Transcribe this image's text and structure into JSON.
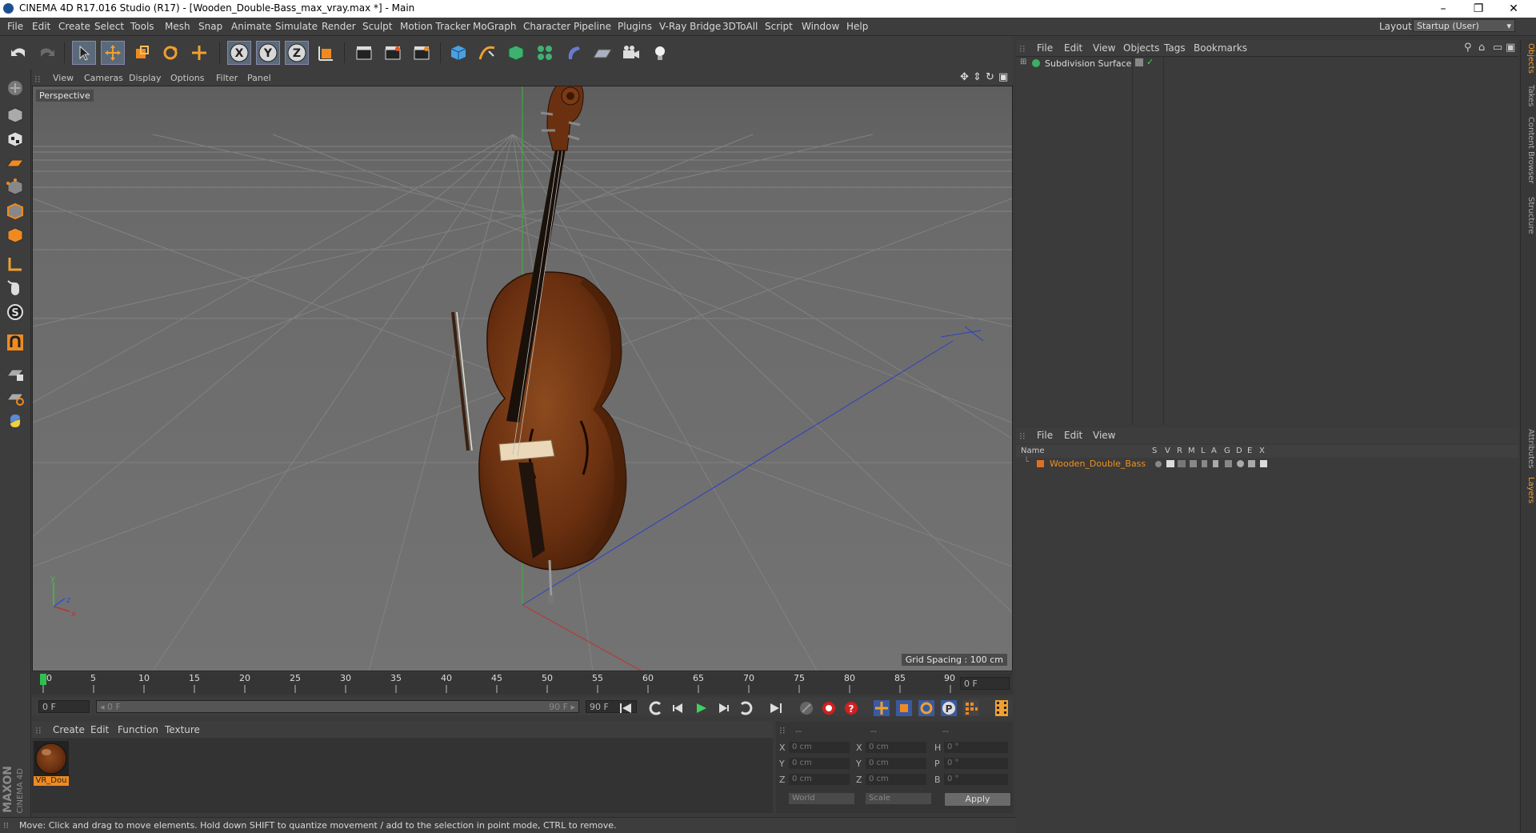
{
  "window": {
    "title": "CINEMA 4D R17.016 Studio (R17) - [Wooden_Double-Bass_max_vray.max *] - Main",
    "controls": [
      "–",
      "❐",
      "✕"
    ]
  },
  "menubar": {
    "items": [
      "File",
      "Edit",
      "Create",
      "Select",
      "Tools",
      "Mesh",
      "Snap",
      "Animate",
      "Simulate",
      "Render",
      "Sculpt",
      "Motion Tracker",
      "MoGraph",
      "Character",
      "Pipeline",
      "Plugins",
      "V-Ray Bridge",
      "3DToAll",
      "Script",
      "Window",
      "Help"
    ],
    "layout_label": "Layout:",
    "layout_value": "Startup (User)"
  },
  "toolbar": {
    "axis_x": "X",
    "axis_y": "Y",
    "axis_z": "Z"
  },
  "viewport": {
    "menu": [
      "View",
      "Cameras",
      "Display",
      "Options",
      "Filter",
      "Panel"
    ],
    "label": "Perspective",
    "grid_spacing": "Grid Spacing : 100 cm",
    "axis_labels": {
      "x": "x",
      "y": "y",
      "z": "z"
    }
  },
  "timeline": {
    "ticks": [
      "0",
      "5",
      "10",
      "15",
      "20",
      "25",
      "30",
      "35",
      "40",
      "45",
      "50",
      "55",
      "60",
      "65",
      "70",
      "75",
      "80",
      "85",
      "90"
    ],
    "current_frame": "0 F",
    "start_field": "0 F",
    "range_start": "◂ 0 F",
    "range_end": "90 F ▸",
    "end_field": "90 F"
  },
  "materials": {
    "menu": [
      "Create",
      "Edit",
      "Function",
      "Texture"
    ],
    "items": [
      {
        "label": "VR_Dou"
      }
    ]
  },
  "coordinates": {
    "headers": [
      "--",
      "--",
      "--"
    ],
    "rows": [
      {
        "a": "X",
        "av": "0 cm",
        "b": "X",
        "bv": "0 cm",
        "c": "H",
        "cv": "0 °"
      },
      {
        "a": "Y",
        "av": "0 cm",
        "b": "Y",
        "bv": "0 cm",
        "c": "P",
        "cv": "0 °"
      },
      {
        "a": "Z",
        "av": "0 cm",
        "b": "Z",
        "bv": "0 cm",
        "c": "B",
        "cv": "0 °"
      }
    ],
    "world": "World",
    "scale": "Scale",
    "apply": "Apply"
  },
  "object_manager": {
    "menu": [
      "File",
      "Edit",
      "View",
      "Objects",
      "Tags",
      "Bookmarks"
    ],
    "objects": [
      {
        "name": "Subdivision Surface"
      }
    ]
  },
  "layer_manager": {
    "menu": [
      "File",
      "Edit",
      "View"
    ],
    "columns": [
      "Name",
      "S",
      "V",
      "R",
      "M",
      "L",
      "A",
      "G",
      "D",
      "E",
      "X"
    ],
    "layers": [
      {
        "name": "Wooden_Double_Bass",
        "color": "#e07020"
      }
    ]
  },
  "right_tabs": [
    "Objects",
    "Takes",
    "Content Browser",
    "Structure",
    "Attributes",
    "Layers"
  ],
  "statusbar": {
    "text": "Move: Click and drag to move elements. Hold down SHIFT to quantize movement / add to the selection in point mode, CTRL to remove."
  },
  "branding": {
    "maxon": "MAXON",
    "cinema": "CINEMA 4D"
  },
  "colors": {
    "accent": "#f08020",
    "active_tool": "#5a6a7a",
    "viewport_bg": "#6e6e6e",
    "layer_name": "#f09020"
  }
}
